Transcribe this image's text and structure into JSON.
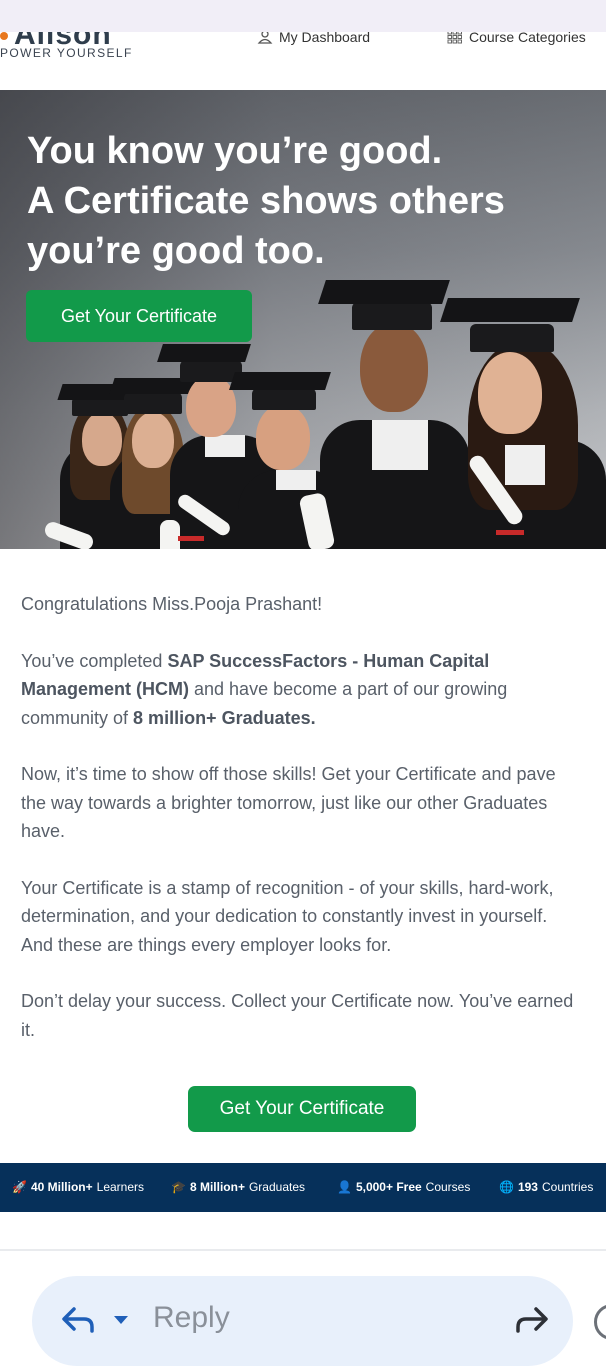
{
  "header": {
    "logo_partial": "Alison",
    "tagline": "POWER YOURSELF",
    "nav": {
      "dashboard": "My Dashboard",
      "categories": "Course Categories"
    }
  },
  "hero": {
    "title_line1": "You know you’re good.",
    "title_line2": "A Certificate shows others",
    "title_line3": "you’re good too.",
    "cta": "Get Your Certificate"
  },
  "message": {
    "greeting": "Congratulations Miss.Pooja Prashant!",
    "p1_pre": "You’ve completed ",
    "p1_course": "SAP SuccessFactors - Human Capital Management (HCM)",
    "p1_mid": " and have become a part of our growing community of ",
    "p1_count": "8 million+ Graduates.",
    "p2": "Now, it’s time to show off those skills! Get your Certificate and pave the way towards a brighter tomorrow, just like our other Graduates have.",
    "p3": "Your Certificate is a stamp of recognition - of your skills, hard-work, determination, and your dedication to constantly invest in yourself. And these are things every employer looks for.",
    "p4": "Don’t delay your success. Collect your Certificate now. You’ve earned it.",
    "cta": "Get Your Certificate"
  },
  "stats": [
    {
      "icon": "rocket-icon",
      "glyph": "🚀",
      "bold": "40 Million+",
      "text": " Learners"
    },
    {
      "icon": "graduation-cap-icon",
      "glyph": "🎓",
      "bold": "8 Million+",
      "text": " Graduates"
    },
    {
      "icon": "person-icon",
      "glyph": "👤",
      "bold": "5,000+ Free",
      "text": " Courses"
    },
    {
      "icon": "globe-icon",
      "glyph": "🌐",
      "bold": "193",
      "text": " Countries"
    }
  ],
  "reply": {
    "label": "Reply"
  }
}
